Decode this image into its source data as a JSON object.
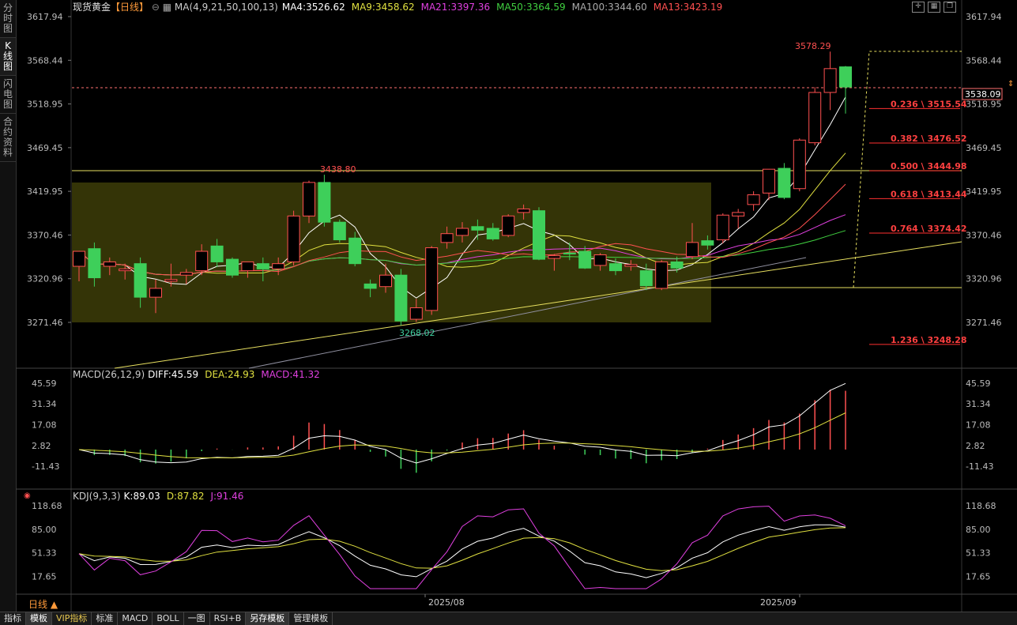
{
  "sidebar": {
    "tabs": [
      {
        "label": "分时图",
        "active": false
      },
      {
        "label": "K线图",
        "active": true
      },
      {
        "label": "闪电图",
        "active": false
      },
      {
        "label": "合约资料",
        "active": false
      }
    ]
  },
  "header": {
    "symbol": "现货黄金",
    "period_tag": "【日线】",
    "indicators": [
      {
        "text": "MA(4,9,21,50,100,13)",
        "color": "#cccccc"
      },
      {
        "text": "MA4:3526.62",
        "color": "#ffffff"
      },
      {
        "text": "MA9:3458.62",
        "color": "#e0e040"
      },
      {
        "text": "MA21:3397.36",
        "color": "#e040e0"
      },
      {
        "text": "MA50:3364.59",
        "color": "#40d040"
      },
      {
        "text": "MA100:3344.60",
        "color": "#aaaaaa"
      },
      {
        "text": "MA13:3423.19",
        "color": "#ff5050"
      }
    ]
  },
  "price_axis": {
    "labels": [
      "3617.94",
      "3568.44",
      "3518.95",
      "3469.45",
      "3419.95",
      "3370.46",
      "3320.96",
      "3271.46"
    ],
    "current_price": "3538.09"
  },
  "annotations": {
    "high": "3578.29",
    "box_high": "3438.80",
    "low": "3268.02"
  },
  "fibonacci": [
    {
      "label": "0.236 \\ 3515.54",
      "price": 3515.54
    },
    {
      "label": "0.382 \\ 3476.52",
      "price": 3476.52
    },
    {
      "label": "0.500 \\ 3444.98",
      "price": 3444.98
    },
    {
      "label": "0.618 \\ 3413.44",
      "price": 3413.44
    },
    {
      "label": "0.764 \\ 3374.42",
      "price": 3374.42
    },
    {
      "label": "1.236 \\ 3248.28",
      "price": 3248.28
    }
  ],
  "macd": {
    "title": "MACD(26,12,9)",
    "diff": "DIFF:45.59",
    "dea": "DEA:24.93",
    "macd": "MACD:41.32",
    "axis": [
      "45.59",
      "31.34",
      "17.08",
      "2.82",
      "-11.43"
    ]
  },
  "kdj": {
    "title": "KDJ(9,3,3)",
    "k": "K:89.03",
    "d": "D:87.82",
    "j": "J:91.46",
    "axis": [
      "118.68",
      "85.00",
      "51.33",
      "17.65"
    ]
  },
  "time_axis": [
    "2025/08",
    "2025/09"
  ],
  "period_button": "日线",
  "bottom_tabs": [
    {
      "label": "指标",
      "selected": false,
      "vip": false
    },
    {
      "label": "模板",
      "selected": true,
      "vip": false
    },
    {
      "label": "VIP指标",
      "selected": false,
      "vip": true
    },
    {
      "label": "标准",
      "selected": false,
      "vip": false
    },
    {
      "label": "MACD",
      "selected": false,
      "vip": false
    },
    {
      "label": "BOLL",
      "selected": false,
      "vip": false
    },
    {
      "label": "一图",
      "selected": false,
      "vip": false
    },
    {
      "label": "RSI+B",
      "selected": false,
      "vip": false
    },
    {
      "label": "另存模板",
      "selected": true,
      "vip": false
    },
    {
      "label": "管理模板",
      "selected": false,
      "vip": false
    }
  ],
  "chart_data": {
    "type": "candlestick",
    "y_range": [
      3271.46,
      3617.94
    ],
    "candles": [
      {
        "o": 3335,
        "h": 3352,
        "l": 3318,
        "c": 3352
      },
      {
        "o": 3355,
        "h": 3362,
        "l": 3312,
        "c": 3322
      },
      {
        "o": 3335,
        "h": 3345,
        "l": 3325,
        "c": 3340
      },
      {
        "o": 3330,
        "h": 3338,
        "l": 3320,
        "c": 3332
      },
      {
        "o": 3338,
        "h": 3345,
        "l": 3288,
        "c": 3300
      },
      {
        "o": 3300,
        "h": 3320,
        "l": 3282,
        "c": 3310
      },
      {
        "o": 3318,
        "h": 3338,
        "l": 3312,
        "c": 3320
      },
      {
        "o": 3325,
        "h": 3332,
        "l": 3315,
        "c": 3328
      },
      {
        "o": 3330,
        "h": 3360,
        "l": 3325,
        "c": 3352
      },
      {
        "o": 3358,
        "h": 3366,
        "l": 3334,
        "c": 3340
      },
      {
        "o": 3343,
        "h": 3345,
        "l": 3322,
        "c": 3325
      },
      {
        "o": 3330,
        "h": 3340,
        "l": 3322,
        "c": 3340
      },
      {
        "o": 3338,
        "h": 3345,
        "l": 3318,
        "c": 3332
      },
      {
        "o": 3332,
        "h": 3345,
        "l": 3325,
        "c": 3338
      },
      {
        "o": 3340,
        "h": 3398,
        "l": 3336,
        "c": 3392
      },
      {
        "o": 3392,
        "h": 3432,
        "l": 3384,
        "c": 3430
      },
      {
        "o": 3430,
        "h": 3438.8,
        "l": 3380,
        "c": 3385
      },
      {
        "o": 3385,
        "h": 3388,
        "l": 3362,
        "c": 3365
      },
      {
        "o": 3367,
        "h": 3374,
        "l": 3335,
        "c": 3338
      },
      {
        "o": 3315,
        "h": 3320,
        "l": 3300,
        "c": 3310
      },
      {
        "o": 3312,
        "h": 3338,
        "l": 3305,
        "c": 3325
      },
      {
        "o": 3325,
        "h": 3332,
        "l": 3268.02,
        "c": 3273
      },
      {
        "o": 3275,
        "h": 3298,
        "l": 3272,
        "c": 3288
      },
      {
        "o": 3285,
        "h": 3358,
        "l": 3280,
        "c": 3356
      },
      {
        "o": 3362,
        "h": 3380,
        "l": 3355,
        "c": 3372
      },
      {
        "o": 3370,
        "h": 3385,
        "l": 3362,
        "c": 3378
      },
      {
        "o": 3380,
        "h": 3388,
        "l": 3365,
        "c": 3376
      },
      {
        "o": 3378,
        "h": 3384,
        "l": 3364,
        "c": 3366
      },
      {
        "o": 3370,
        "h": 3394,
        "l": 3368,
        "c": 3392
      },
      {
        "o": 3396,
        "h": 3405,
        "l": 3388,
        "c": 3400
      },
      {
        "o": 3398,
        "h": 3402,
        "l": 3342,
        "c": 3343
      },
      {
        "o": 3344,
        "h": 3349,
        "l": 3330,
        "c": 3347
      },
      {
        "o": 3350,
        "h": 3362,
        "l": 3342,
        "c": 3349
      },
      {
        "o": 3352,
        "h": 3358,
        "l": 3332,
        "c": 3333
      },
      {
        "o": 3336,
        "h": 3350,
        "l": 3330,
        "c": 3348
      },
      {
        "o": 3338,
        "h": 3344,
        "l": 3325,
        "c": 3330
      },
      {
        "o": 3335,
        "h": 3342,
        "l": 3330,
        "c": 3337
      },
      {
        "o": 3330,
        "h": 3338,
        "l": 3308,
        "c": 3313
      },
      {
        "o": 3310,
        "h": 3342,
        "l": 3308,
        "c": 3340
      },
      {
        "o": 3340,
        "h": 3346,
        "l": 3328,
        "c": 3333
      },
      {
        "o": 3346,
        "h": 3384,
        "l": 3343,
        "c": 3362
      },
      {
        "o": 3364,
        "h": 3370,
        "l": 3354,
        "c": 3359
      },
      {
        "o": 3365,
        "h": 3395,
        "l": 3361,
        "c": 3393
      },
      {
        "o": 3392,
        "h": 3400,
        "l": 3378,
        "c": 3396
      },
      {
        "o": 3405,
        "h": 3420,
        "l": 3398,
        "c": 3416
      },
      {
        "o": 3418,
        "h": 3445,
        "l": 3410,
        "c": 3445
      },
      {
        "o": 3446,
        "h": 3452,
        "l": 3411,
        "c": 3413
      },
      {
        "o": 3423,
        "h": 3480,
        "l": 3420,
        "c": 3478
      },
      {
        "o": 3475,
        "h": 3538,
        "l": 3472,
        "c": 3532
      },
      {
        "o": 3532,
        "h": 3578.29,
        "l": 3512,
        "c": 3559
      },
      {
        "o": 3561,
        "h": 3562,
        "l": 3508,
        "c": 3538.09
      }
    ]
  }
}
